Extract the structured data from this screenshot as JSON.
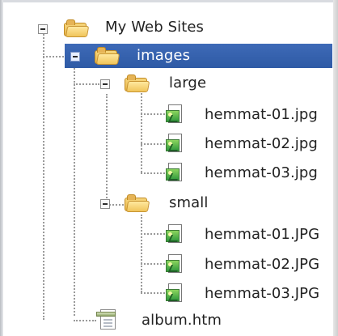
{
  "tree": {
    "root": {
      "label": "My Web Sites",
      "expander": "minus",
      "icon": "folder-icon"
    },
    "images": {
      "label": "images",
      "expander": "minus",
      "icon": "folder-icon",
      "selected": true,
      "selected_color": "#315ca8"
    },
    "large": {
      "label": "large",
      "expander": "minus",
      "icon": "folder-icon",
      "files": [
        {
          "label": "hemmat-01.jpg",
          "icon": "image-file-icon"
        },
        {
          "label": "hemmat-02.jpg",
          "icon": "image-file-icon"
        },
        {
          "label": "hemmat-03.jpg",
          "icon": "image-file-icon"
        }
      ]
    },
    "small": {
      "label": "small",
      "expander": "minus",
      "icon": "folder-icon",
      "files": [
        {
          "label": "hemmat-01.JPG",
          "icon": "image-file-icon"
        },
        {
          "label": "hemmat-02.JPG",
          "icon": "image-file-icon"
        },
        {
          "label": "hemmat-03.JPG",
          "icon": "image-file-icon"
        }
      ]
    },
    "album": {
      "label": "album.htm",
      "icon": "html-file-icon"
    }
  },
  "colors": {
    "selection": "#315ca8",
    "text": "#222222",
    "tree_lines": "#9a9a9a",
    "folder": "#f1c45e",
    "image_icon": "#2f9a3d"
  }
}
